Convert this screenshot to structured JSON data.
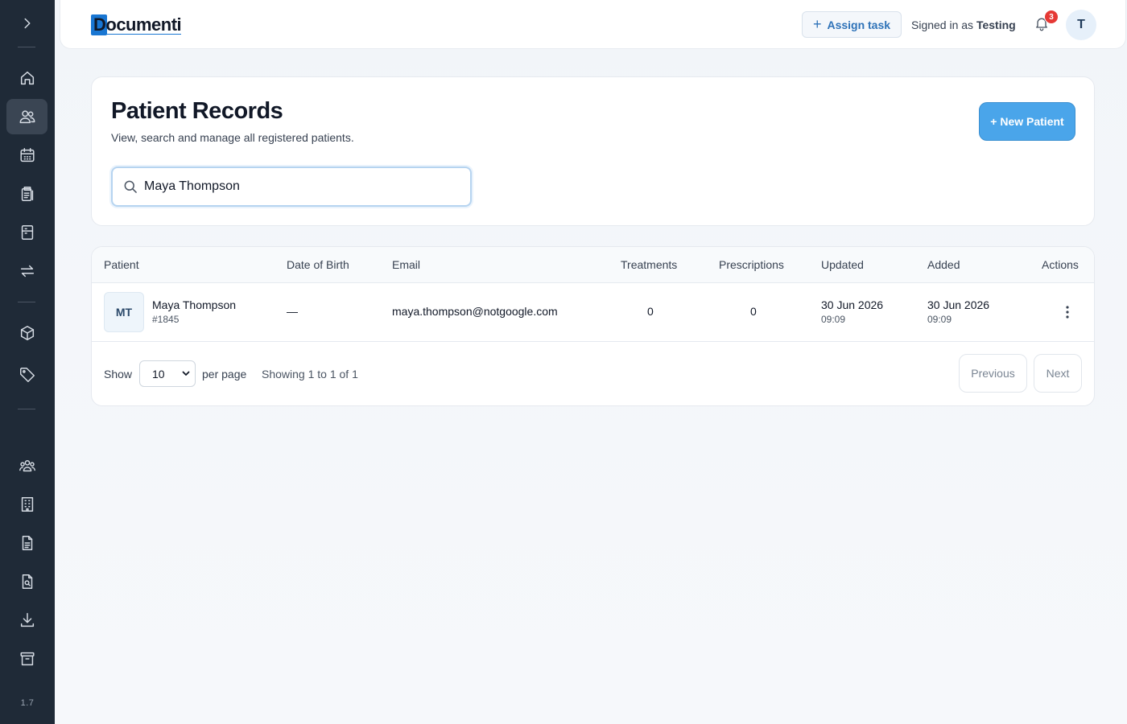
{
  "sidebar": {
    "version": "1.7",
    "items": [
      {
        "icon": "chevron-right-icon"
      },
      {
        "icon": "home-icon"
      },
      {
        "icon": "users-icon",
        "active": true
      },
      {
        "icon": "calendar-icon"
      },
      {
        "icon": "clipboard-list-icon"
      },
      {
        "icon": "cabinet-icon"
      },
      {
        "icon": "arrows-exchange-icon"
      },
      {
        "icon": "box-icon"
      },
      {
        "icon": "tag-icon"
      },
      {
        "icon": "group-icon"
      },
      {
        "icon": "building-icon"
      },
      {
        "icon": "document-icon"
      },
      {
        "icon": "document-search-icon"
      },
      {
        "icon": "download-icon"
      },
      {
        "icon": "archive-icon"
      }
    ]
  },
  "header": {
    "logo_text": "Documenti",
    "assign_task_label": "Assign task",
    "signed_in_prefix": "Signed in as",
    "signed_in_user": "Testing",
    "notification_count": "3",
    "avatar_initial": "T"
  },
  "page": {
    "title": "Patient Records",
    "subtitle": "View, search and manage all registered patients.",
    "new_patient_label": "+ New Patient",
    "search_value": "Maya Thompson"
  },
  "table": {
    "columns": [
      "Patient",
      "Date of Birth",
      "Email",
      "Treatments",
      "Prescriptions",
      "Updated",
      "Added",
      "Actions"
    ],
    "rows": [
      {
        "initials": "MT",
        "name": "Maya Thompson",
        "id": "#1845",
        "dob": "—",
        "email": "maya.thompson@notgoogle.com",
        "treatments": "0",
        "prescriptions": "0",
        "updated_date": "30 Jun 2026",
        "updated_time": "09:09",
        "added_date": "30 Jun 2026",
        "added_time": "09:09"
      }
    ]
  },
  "pagination": {
    "show_label": "Show",
    "per_page_value": "10",
    "per_page_label": "per page",
    "showing_text": "Showing 1 to 1 of 1",
    "previous_label": "Previous",
    "next_label": "Next"
  }
}
